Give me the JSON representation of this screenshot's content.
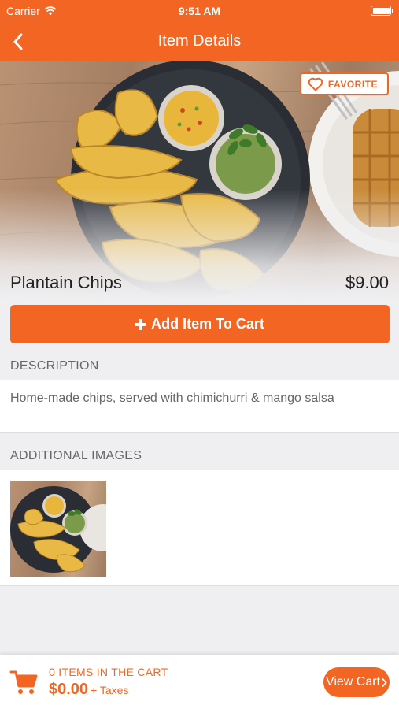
{
  "status_bar": {
    "carrier": "Carrier",
    "time": "9:51 AM"
  },
  "nav": {
    "title": "Item Details",
    "back_icon": "chevron-left-icon"
  },
  "item": {
    "name": "Plantain Chips",
    "price": "$9.00",
    "favorite_label": "FAVORITE",
    "add_to_cart_label": "Add Item To Cart"
  },
  "description": {
    "header": "DESCRIPTION",
    "text": "Home-made chips, served with chimichurri & mango salsa"
  },
  "additional_images": {
    "header": "ADDITIONAL IMAGES",
    "count": 1
  },
  "cart": {
    "count_label": "0 ITEMS IN THE CART",
    "total": "$0.00",
    "taxes_label": "+ Taxes",
    "view_cart_label": "View Cart"
  },
  "colors": {
    "accent": "#f26522",
    "background": "#efeff1"
  }
}
